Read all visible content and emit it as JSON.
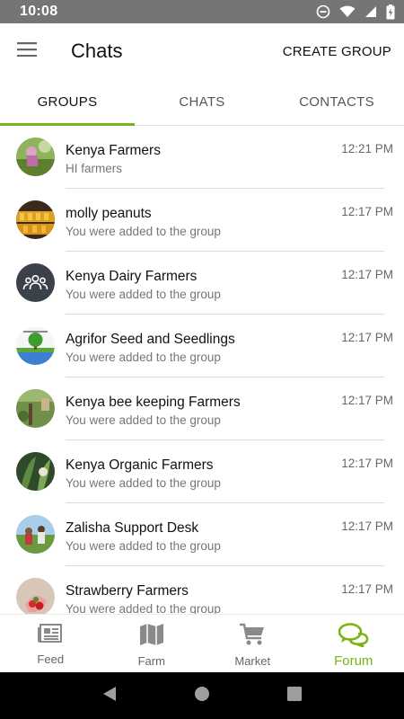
{
  "status_bar": {
    "time": "10:08",
    "icons": [
      "do-not-disturb-icon",
      "wifi-icon",
      "signal-icon",
      "battery-charging-icon"
    ]
  },
  "app_bar": {
    "title": "Chats",
    "action": "CREATE GROUP",
    "menu_icon": "hamburger-menu-icon"
  },
  "tabs": [
    {
      "label": "GROUPS",
      "active": true
    },
    {
      "label": "CHATS",
      "active": false
    },
    {
      "label": "CONTACTS",
      "active": false
    }
  ],
  "chats": [
    {
      "name": "Kenya Farmers",
      "message": "HI farmers",
      "time": "12:21 PM"
    },
    {
      "name": "molly peanuts",
      "message": "You were added to the group",
      "time": "12:17 PM"
    },
    {
      "name": "Kenya Dairy Farmers",
      "message": "You were added to the group",
      "time": "12:17 PM"
    },
    {
      "name": "Agrifor Seed and Seedlings",
      "message": "You were added to the group",
      "time": "12:17 PM"
    },
    {
      "name": "Kenya bee keeping Farmers",
      "message": "You were added to the group",
      "time": "12:17 PM"
    },
    {
      "name": "Kenya Organic Farmers",
      "message": "You were added to the group",
      "time": "12:17 PM"
    },
    {
      "name": "Zalisha Support Desk",
      "message": "You were added to the group",
      "time": "12:17 PM"
    },
    {
      "name": "Strawberry Farmers",
      "message": "You were added to the group",
      "time": "12:17 PM"
    }
  ],
  "bottom_nav": [
    {
      "label": "Feed",
      "icon": "newspaper-icon",
      "active": false
    },
    {
      "label": "Farm",
      "icon": "map-icon",
      "active": false
    },
    {
      "label": "Market",
      "icon": "cart-icon",
      "active": false
    },
    {
      "label": "Forum",
      "icon": "chat-bubbles-icon",
      "active": true
    }
  ],
  "colors": {
    "accent": "#7ab317",
    "status_bar": "#757575",
    "system_nav": "#000000"
  }
}
